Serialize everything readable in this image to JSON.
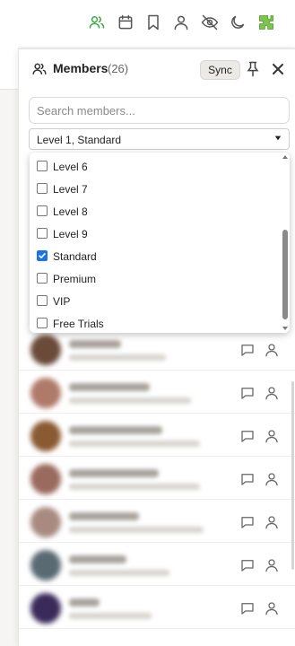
{
  "toolbar": {
    "icons": [
      "members-icon",
      "calendar-icon",
      "bookmark-icon",
      "profile-icon",
      "hide-icon",
      "dark-mode-icon",
      "extension-icon"
    ],
    "active_color": "#39a845",
    "icon_color": "#555555"
  },
  "panel": {
    "title": "Members",
    "count": "(26)",
    "sync_label": "Sync"
  },
  "search": {
    "placeholder": "Search members...",
    "value": ""
  },
  "filter": {
    "selected": "Level 1, Standard",
    "options": [
      {
        "label": "Level 6",
        "checked": false
      },
      {
        "label": "Level 7",
        "checked": false
      },
      {
        "label": "Level 8",
        "checked": false
      },
      {
        "label": "Level 9",
        "checked": false
      },
      {
        "label": "Standard",
        "checked": true
      },
      {
        "label": "Premium",
        "checked": false
      },
      {
        "label": "VIP",
        "checked": false
      },
      {
        "label": "Free Trials",
        "checked": false
      }
    ]
  },
  "members": [
    {
      "avatar_color": "#6b4a3a"
    },
    {
      "avatar_color": "#b07a6a"
    },
    {
      "avatar_color": "#8a5a32"
    },
    {
      "avatar_color": "#9a6a5e"
    },
    {
      "avatar_color": "#a88a80"
    },
    {
      "avatar_color": "#5a6a72"
    },
    {
      "avatar_color": "#3a2a5a"
    }
  ],
  "colors": {
    "accent": "#1a73e8",
    "sync_bg": "#eceae6"
  }
}
